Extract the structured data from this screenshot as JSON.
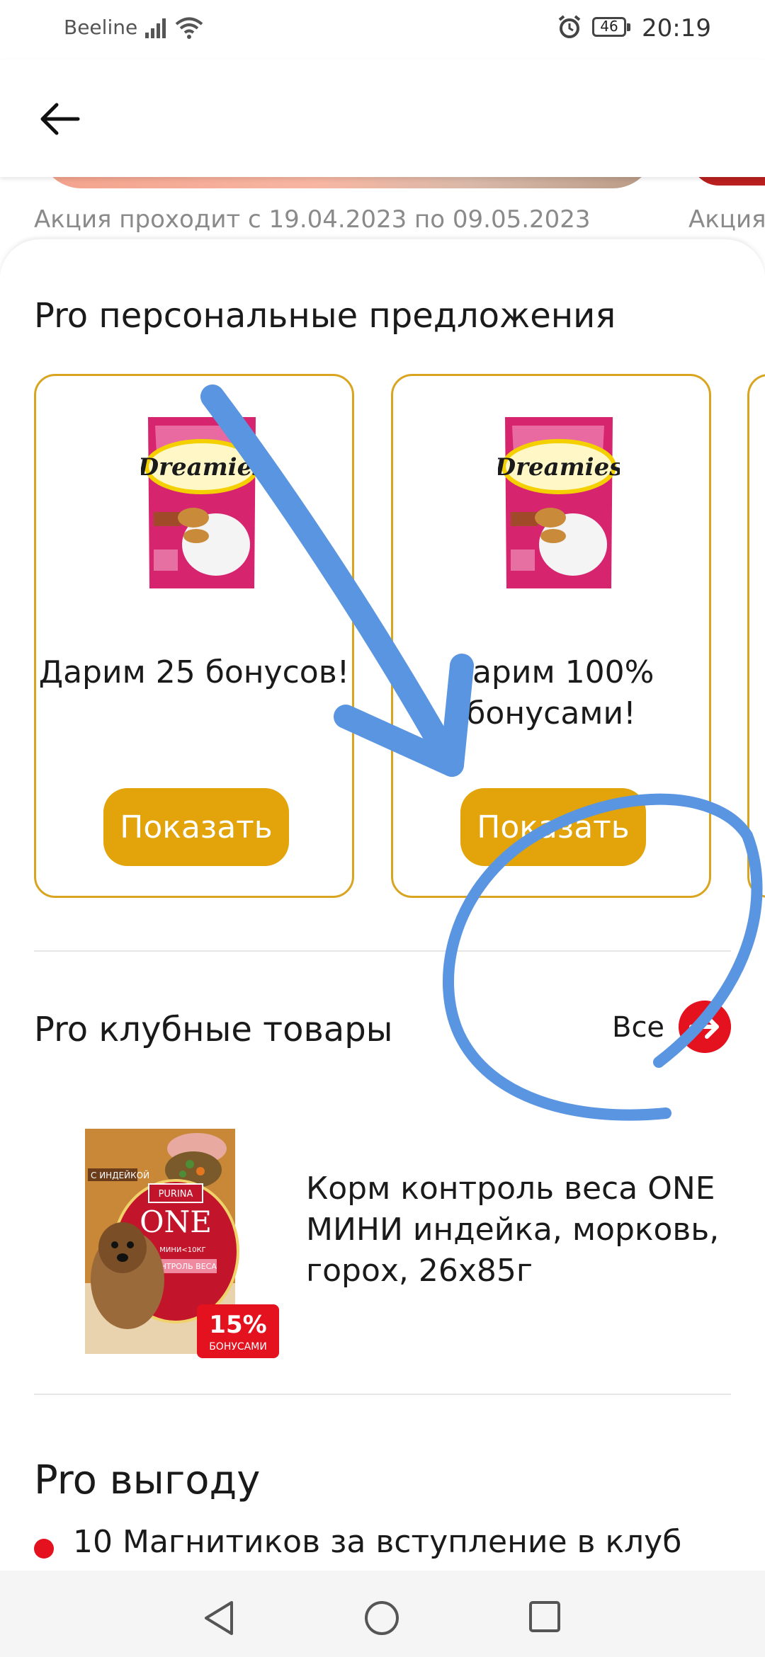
{
  "status_bar": {
    "carrier": "Beeline",
    "battery": "46",
    "time": "20:19"
  },
  "header": {
    "back_icon": "arrow-left-icon"
  },
  "promo": {
    "dates": "Акция проходит с 19.04.2023 по 09.05.2023",
    "dates_next": "Акция"
  },
  "personal_offers": {
    "title": "Pro персональные предложения",
    "cards": [
      {
        "brand": "Dreamies",
        "text": "Дарим 25 бонусов!",
        "button": "Показать"
      },
      {
        "brand": "Dreamies",
        "text": "Дарим 100% бонусами!",
        "button": "Показать"
      }
    ]
  },
  "club_products": {
    "title": "Pro клубные товары",
    "all_label": "Все",
    "items": [
      {
        "name": "Корм контроль веса ONE МИНИ индейка, морковь, горох, 26х85г",
        "pack_flavor": "С ИНДЕЙКОЙ",
        "pack_brand": "PURINA",
        "pack_line": "ONE",
        "pack_variant": "МИНИ<10КГ",
        "pack_label": "КОНТРОЛЬ ВЕСА",
        "badge_percent": "15%",
        "badge_text": "БОНУСАМИ"
      }
    ]
  },
  "benefits": {
    "title": "Pro выгоду",
    "items": [
      "10 Магнитиков за вступление в клуб"
    ]
  },
  "colors": {
    "accent_yellow": "#e2a40a",
    "card_border": "#d9a520",
    "brand_red": "#e4121f",
    "annotation_blue": "#5a95e2"
  }
}
